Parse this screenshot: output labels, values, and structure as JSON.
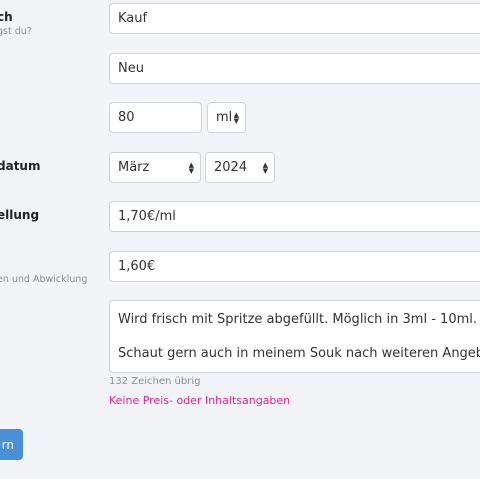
{
  "labels": {
    "angebot": "ch",
    "angebot_sub": "gst du?",
    "datum": "datum",
    "bestellung": "ellung",
    "versand_sub": "en und Abwicklung"
  },
  "fields": {
    "type": "Kauf",
    "condition": "Neu",
    "amount": "80",
    "unit": "ml",
    "month": "März",
    "year": "2024",
    "price_per_unit": "1,70€/ml",
    "shipping": "1,60€"
  },
  "description": {
    "line1": "Wird frisch mit Spritze abgefüllt. Möglich in 3ml - 10ml.",
    "line2": "Schaut gern auch in meinem Souk nach weiteren Angeboten! 😉",
    "remaining": "132 Zeichen übrig"
  },
  "warning": "Keine Preis- oder Inhaltsangaben",
  "submit_label": "rn"
}
